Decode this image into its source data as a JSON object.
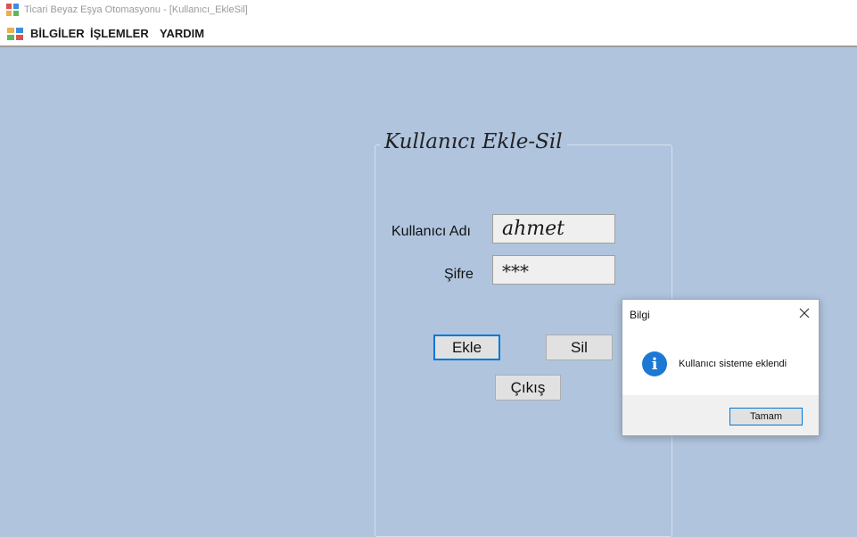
{
  "window": {
    "title": "Ticari Beyaz Eşya Otomasyonu - [Kullanıcı_EkleSil]",
    "app_icon": "app-window-icon"
  },
  "menubar": {
    "icon": "mdi-window-icon",
    "items": [
      {
        "label": "BİLGİLER"
      },
      {
        "label": "İŞLEMLER"
      },
      {
        "label": "YARDIM"
      }
    ]
  },
  "form": {
    "group_title": "Kullanıcı Ekle-Sil",
    "username_label": "Kullanıcı Adı",
    "username_value": "ahmet",
    "password_label": "Şifre",
    "password_value": "***",
    "add_button": "Ekle",
    "delete_button": "Sil",
    "exit_button": "Çıkış"
  },
  "dialog": {
    "title": "Bilgi",
    "message": "Kullanıcı sisteme eklendi",
    "ok_button": "Tamam",
    "icon": "info-icon",
    "close_icon": "close-icon"
  },
  "colors": {
    "background": "#b0c4de",
    "accent": "#0078d7",
    "info_icon": "#1d78d4"
  }
}
